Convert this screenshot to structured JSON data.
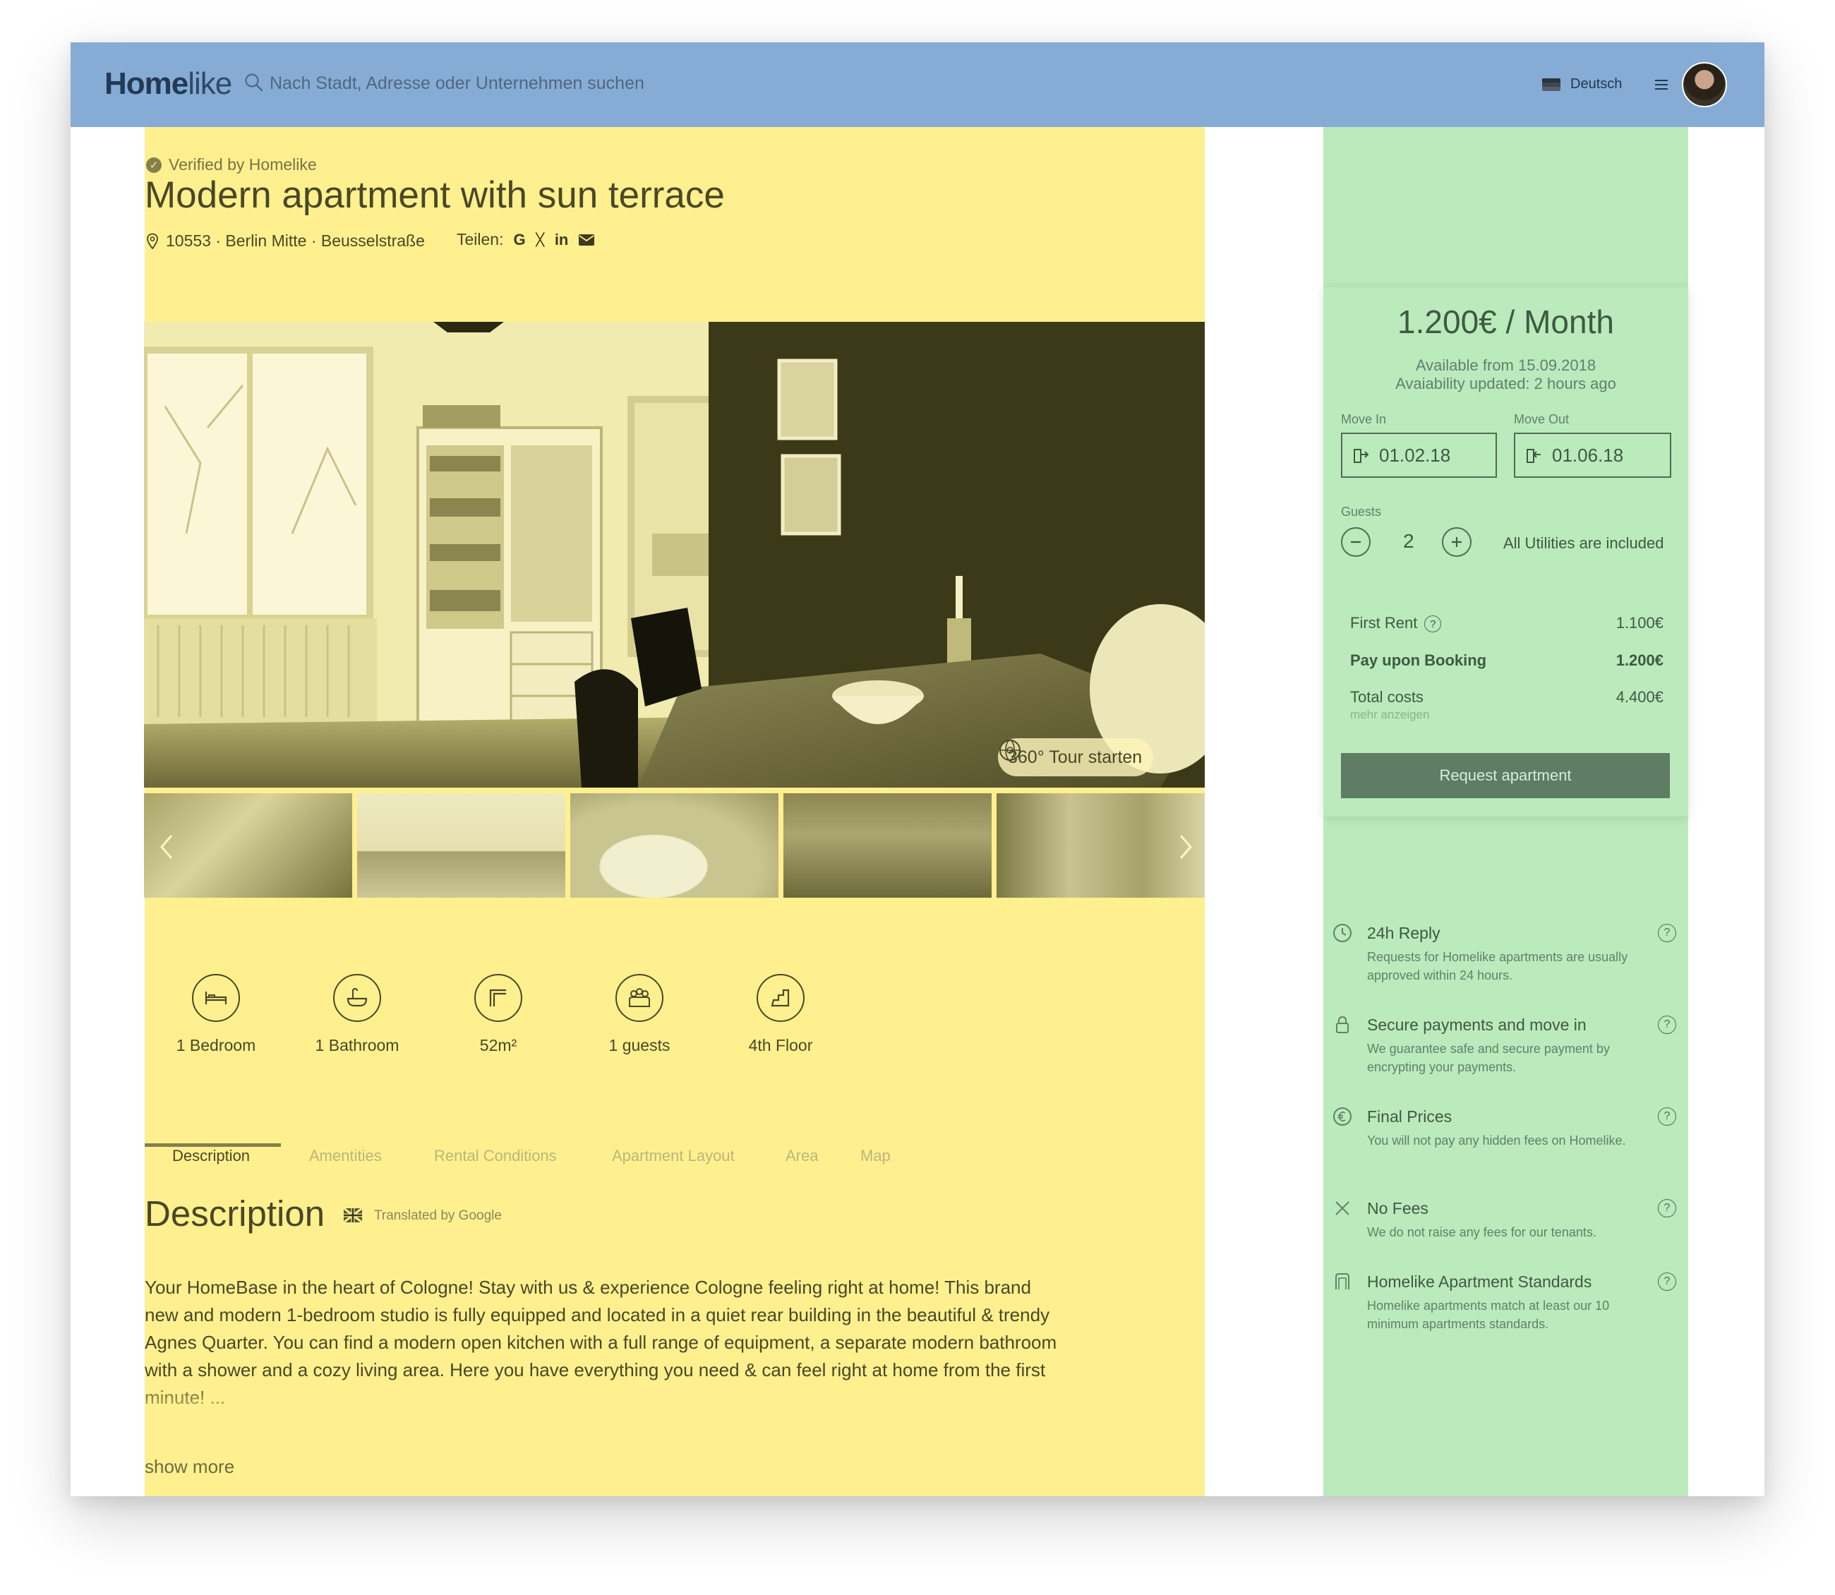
{
  "header": {
    "logo_bold": "Home",
    "logo_light": "like",
    "search_placeholder": "Nach Stadt, Adresse oder Unternehmen suchen",
    "language": "Deutsch"
  },
  "listing": {
    "verified": "Verified by Homelike",
    "title": "Modern apartment with sun terrace",
    "address": "10553 · Berlin Mitte · Beusselstraße",
    "share_label": "Teilen:",
    "tour_label": "360° Tour starten"
  },
  "features": [
    {
      "label": "1 Bedroom",
      "icon": "bed-icon"
    },
    {
      "label": "1 Bathroom",
      "icon": "bathtub-icon"
    },
    {
      "label": "52m²",
      "icon": "area-icon"
    },
    {
      "label": "1 guests",
      "icon": "guests-icon"
    },
    {
      "label": "4th Floor",
      "icon": "stairs-icon"
    }
  ],
  "tabs": [
    "Description",
    "Amentities",
    "Rental Conditions",
    "Apartment Layout",
    "Area",
    "Map"
  ],
  "description": {
    "heading": "Description",
    "translated": "Translated by Google",
    "text": "Your HomeBase in the heart of Cologne!  Stay with us & experience Cologne feeling right at home!  This brand new and modern 1-bedroom studio is fully equipped and located in a quiet rear building in the beautiful & trendy Agnes Quarter.  You can find a modern open kitchen with a full range of equipment, a separate modern bathroom with a shower and a cozy living area. Here you have everything you need & can feel right at home from the first minute! ...",
    "show_more": "show more"
  },
  "booking": {
    "price": "1.200€ / Month",
    "available_from": "Available from 15.09.2018",
    "availability_updated": "Avaiability updated: 2 hours ago",
    "move_in_label": "Move In",
    "move_in_value": "01.02.18",
    "move_out_label": "Move Out",
    "move_out_value": "01.06.18",
    "guests_label": "Guests",
    "guests_value": "2",
    "utilities": "All Utilities are included",
    "first_rent_label": "First Rent",
    "first_rent_value": "1.100€",
    "pay_booking_label": "Pay upon Booking",
    "pay_booking_value": "1.200€",
    "total_label": "Total costs",
    "total_value": "4.400€",
    "show_more_costs": "mehr anzeigen",
    "request_button": "Request apartment"
  },
  "perks": [
    {
      "title": "24h Reply",
      "desc": "Requests for Homelike apartments are usually approved within 24 hours.",
      "icon": "clock-icon"
    },
    {
      "title": "Secure payments and move in",
      "desc": "We guarantee safe and secure payment by encrypting your payments.",
      "icon": "lock-icon"
    },
    {
      "title": "Final Prices",
      "desc": "You will not pay any hidden fees on Homelike.",
      "icon": "euro-icon"
    },
    {
      "title": "No Fees",
      "desc": "We do not raise any fees for our tenants.",
      "icon": "x-icon"
    },
    {
      "title": "Homelike Apartment Standards",
      "desc": "Homelike apartments match at least our 10 minimum apartments standards.",
      "icon": "door-icon"
    }
  ],
  "colors": {
    "header_bg": "#86acd6",
    "main_bg": "#fef08f",
    "sidebar_bg": "#bbeabd",
    "request_button_bg": "#5e7d64"
  }
}
